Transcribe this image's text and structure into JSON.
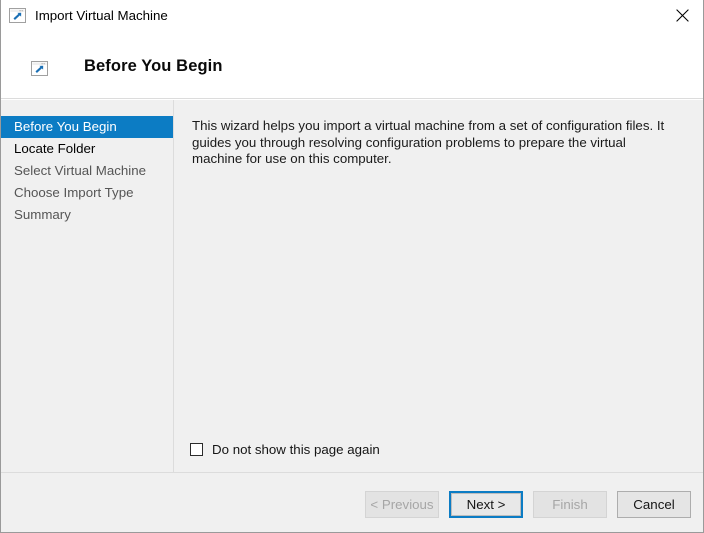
{
  "window": {
    "title": "Import Virtual Machine",
    "title_icon": "import-vm-icon",
    "close_icon": "close-icon"
  },
  "header": {
    "icon": "import-vm-icon",
    "title": "Before You Begin"
  },
  "sidebar": {
    "items": [
      {
        "label": "Before You Begin",
        "state": "current"
      },
      {
        "label": "Locate Folder",
        "state": "active"
      },
      {
        "label": "Select Virtual Machine",
        "state": "upcoming"
      },
      {
        "label": "Choose Import Type",
        "state": "upcoming"
      },
      {
        "label": "Summary",
        "state": "upcoming"
      }
    ]
  },
  "content": {
    "intro_text": "This wizard helps you import a virtual machine from a set of configuration files. It guides you through resolving configuration problems to prepare the virtual machine for use on this computer.",
    "checkbox": {
      "label": "Do not show this page again",
      "checked": false
    }
  },
  "footer": {
    "buttons": [
      {
        "label": "< Previous",
        "state": "disabled"
      },
      {
        "label": "Next >",
        "state": "default"
      },
      {
        "label": "Finish",
        "state": "disabled"
      },
      {
        "label": "Cancel",
        "state": "enabled"
      }
    ]
  },
  "colors": {
    "accent": "#0c7cc4",
    "body_background": "#f0f0f0",
    "divider": "#dcdcdc",
    "window_border": "#9a9a9a"
  }
}
